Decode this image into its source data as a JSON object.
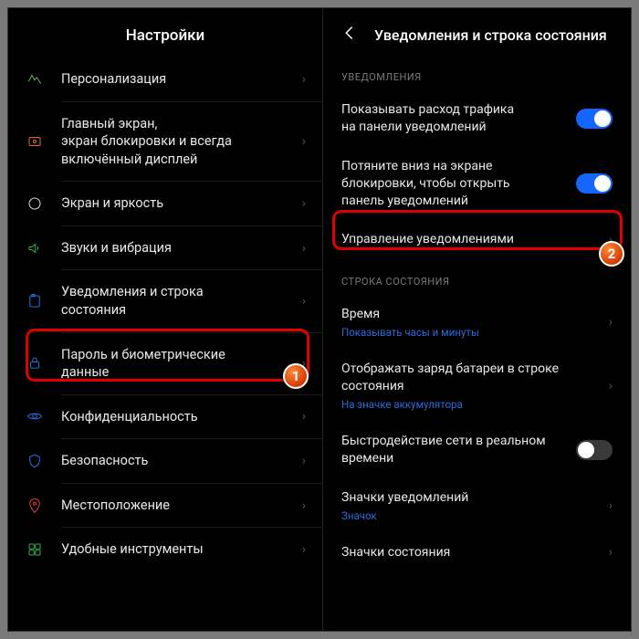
{
  "left": {
    "title": "Настройки",
    "items": [
      {
        "label": "Персонализация",
        "icon": "personalization",
        "color": "#52b54a"
      },
      {
        "label": "Главный экран,\nэкран блокировки и всегда\nвключённый дисплей",
        "icon": "home-lock",
        "color": "#e06a2b"
      },
      {
        "label": "Экран и яркость",
        "icon": "brightness",
        "color": "#d8d8d8"
      },
      {
        "label": "Звуки и вибрация",
        "icon": "sound",
        "color": "#3aa84a"
      },
      {
        "label": "Уведомления и строка\nсостояния",
        "icon": "notifications",
        "color": "#2a6ad9",
        "highlighted": true
      },
      {
        "label": "Пароль и биометрические\nданные",
        "icon": "lock",
        "color": "#2a6ad9"
      },
      {
        "label": "Конфиденциальность",
        "icon": "privacy",
        "color": "#2a6ad9"
      },
      {
        "label": "Безопасность",
        "icon": "shield",
        "color": "#2a6ad9"
      },
      {
        "label": "Местоположение",
        "icon": "location",
        "color": "#d83a3a"
      },
      {
        "label": "Удобные инструменты",
        "icon": "tools",
        "color": "#3aa84a"
      }
    ]
  },
  "right": {
    "title": "Уведомления и строка состояния",
    "sections": [
      {
        "header": "УВЕДОМЛЕНИЯ",
        "items": [
          {
            "label": "Показывать расход трафика\nна панели уведомлений",
            "control": "toggle",
            "value": true
          },
          {
            "label": "Потяните вниз на экране\nблокировки, чтобы открыть\nпанель уведомлений",
            "control": "toggle",
            "value": true
          },
          {
            "label": "Управление уведомлениями",
            "control": "nav",
            "highlighted": true
          }
        ]
      },
      {
        "header": "СТРОКА СОСТОЯНИЯ",
        "items": [
          {
            "label": "Время",
            "sub": "Показывать часы и минуты",
            "control": "nav"
          },
          {
            "label": "Отображать заряд батареи в строке\nсостояния",
            "sub": "На значке аккумулятора",
            "control": "nav"
          },
          {
            "label": "Быстродействие сети в реальном\nвремени",
            "control": "toggle",
            "value": false
          },
          {
            "label": "Значки уведомлений",
            "sub": "Значок",
            "control": "nav"
          },
          {
            "label": "Значки состояния",
            "control": "nav"
          }
        ]
      }
    ]
  },
  "badges": {
    "b1": "1",
    "b2": "2"
  }
}
